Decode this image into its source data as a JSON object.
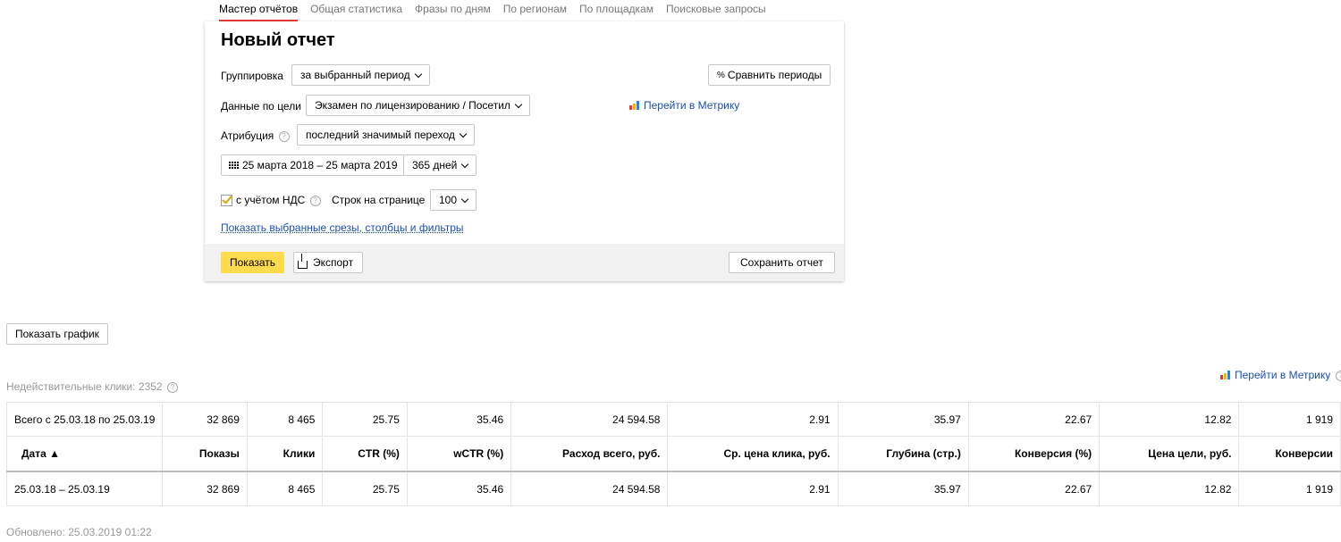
{
  "tabs": [
    {
      "label": "Мастер отчётов",
      "active": true
    },
    {
      "label": "Общая статистика"
    },
    {
      "label": "Фразы по дням"
    },
    {
      "label": "По регионам"
    },
    {
      "label": "По площадкам"
    },
    {
      "label": "Поисковые запросы"
    }
  ],
  "report": {
    "title": "Новый отчет",
    "grouping_label": "Группировка",
    "grouping_value": "за выбранный период",
    "compare_button": "Сравнить периоды",
    "goal_label": "Данные по цели",
    "goal_value": "Экзамен по лицензированию / Посетил",
    "metrika_link": "Перейти в Метрику",
    "attribution_label": "Атрибуция",
    "attribution_value": "последний значимый переход",
    "date_range": "25 марта 2018 – 25 марта 2019",
    "period_value": "365 дней",
    "vat_label": "с учётом НДС",
    "vat_checked": true,
    "rows_label": "Строк на странице",
    "rows_value": "100",
    "show_selected_link": "Показать выбранные срезы, столбцы и фильтры",
    "show_button": "Показать",
    "export_button": "Экспорт",
    "save_button": "Сохранить отчет"
  },
  "show_chart_button": "Показать график",
  "invalid_clicks": "Недействительные клики: 2352",
  "metrika_link_right": "Перейти в Метрику",
  "table": {
    "total_row": [
      "Всего с 25.03.18 по 25.03.19",
      "32 869",
      "8 465",
      "25.75",
      "35.46",
      "24 594.58",
      "2.91",
      "35.97",
      "22.67",
      "12.82",
      "1 919"
    ],
    "headers": [
      "Дата ▲",
      "Показы",
      "Клики",
      "CTR (%)",
      "wCTR (%)",
      "Расход всего, руб.",
      "Ср. цена клика, руб.",
      "Глубина (стр.)",
      "Конверсия (%)",
      "Цена цели, руб.",
      "Конверсии"
    ],
    "rows": [
      [
        "25.03.18 – 25.03.19",
        "32 869",
        "8 465",
        "25.75",
        "35.46",
        "24 594.58",
        "2.91",
        "35.97",
        "22.67",
        "12.82",
        "1 919"
      ]
    ]
  },
  "updated": "Обновлено: 25.03.2019 01:22",
  "colors": {
    "accent_tab": "#e53935",
    "primary_button": "#ffdb4d",
    "link": "#1a4fb0"
  },
  "icons": {
    "compare": "percent-icon",
    "calendar": "calendar-icon",
    "export": "export-icon",
    "metrika": "metrika-icon",
    "help": "question-icon"
  }
}
